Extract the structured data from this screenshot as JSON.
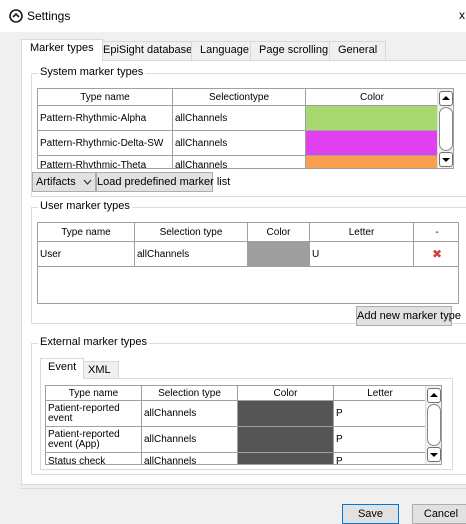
{
  "window": {
    "title": "Settings",
    "close_glyph": "x",
    "icon": "settings-app-icon"
  },
  "tabs": [
    {
      "label": "Marker types",
      "active": true
    },
    {
      "label": "EpiSight database"
    },
    {
      "label": "Language"
    },
    {
      "label": "Page scrolling"
    },
    {
      "label": "General"
    }
  ],
  "system_markers": {
    "title": "System marker types",
    "headers": [
      "Type name",
      "Selectiontype",
      "Color"
    ],
    "rows": [
      {
        "name": "Pattern-Rhythmic-Alpha",
        "selection": "allChannels",
        "color": "#a8d870"
      },
      {
        "name": "Pattern-Rhythmic-Delta-SW",
        "selection": "allChannels",
        "color": "#e040f0"
      },
      {
        "name": "Pattern-Rhythmic-Theta",
        "selection": "allChannels",
        "color": "#f8a050"
      }
    ],
    "dropdown_value": "Artifacts",
    "load_button": "Load predefined marker list"
  },
  "user_markers": {
    "title": "User marker types",
    "headers": [
      "Type name",
      "Selection type",
      "Color",
      "Letter",
      "-"
    ],
    "rows": [
      {
        "name": "User",
        "selection": "allChannels",
        "color": "#9e9e9e",
        "letter": "U"
      }
    ],
    "delete_glyph": "✖",
    "add_button": "Add new marker type"
  },
  "external_markers": {
    "title": "External marker types",
    "subtabs": [
      {
        "label": "Event",
        "active": true
      },
      {
        "label": "XML"
      }
    ],
    "headers": [
      "Type name",
      "Selection type",
      "Color",
      "Letter"
    ],
    "rows": [
      {
        "name": "Patient-reported event",
        "selection": "allChannels",
        "color": "#555555",
        "letter": "P"
      },
      {
        "name": "Patient-reported event (App)",
        "selection": "allChannels",
        "color": "#555555",
        "letter": "P"
      },
      {
        "name": "Status check",
        "selection": "allChannels",
        "color": "#555555",
        "letter": "P"
      }
    ]
  },
  "footer": {
    "save": "Save",
    "cancel": "Cancel"
  },
  "colors": {
    "accent": "#0078d7",
    "delete": "#d04040"
  }
}
